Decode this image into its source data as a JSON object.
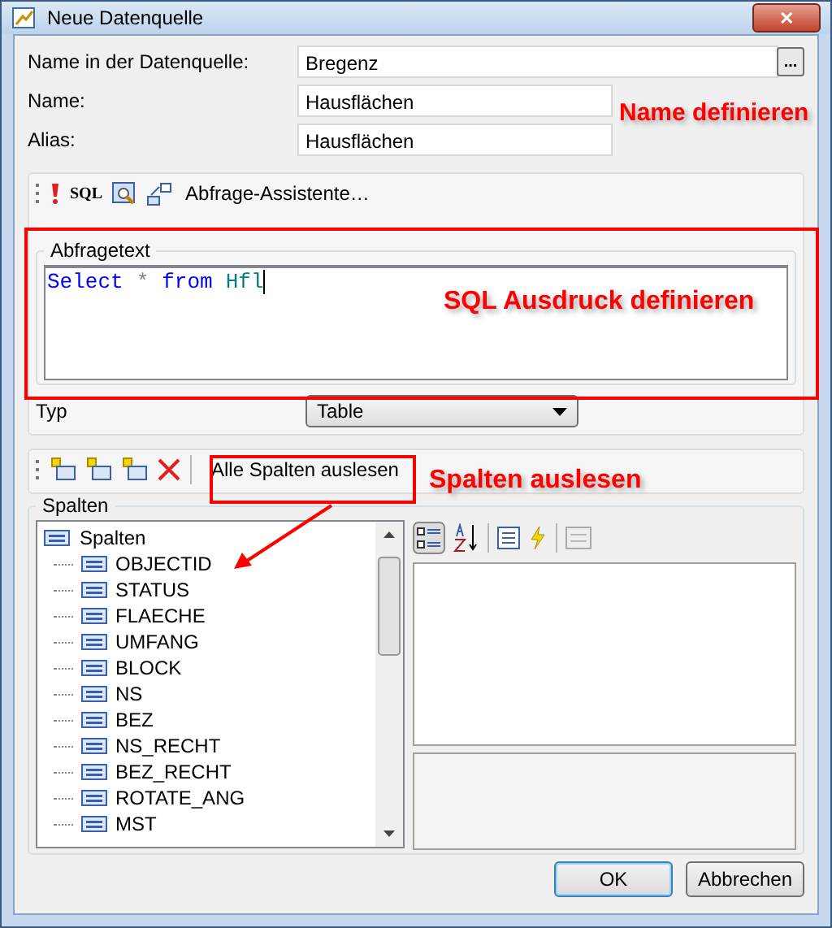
{
  "window": {
    "title": "Neue Datenquelle",
    "close": "✕"
  },
  "fields": [
    {
      "label": "Name in der Datenquelle:",
      "value": "Bregenz",
      "kind": "wide",
      "browse": "..."
    },
    {
      "label": "Name:",
      "value": "Hausflächen",
      "kind": "short"
    },
    {
      "label": "Alias:",
      "value": "Hausflächen",
      "kind": "short"
    }
  ],
  "query_toolbar": {
    "sql": "SQL",
    "wizard": "Abfrage-Assistente…"
  },
  "query_group": {
    "title": "Abfragetext",
    "tokens": [
      {
        "text": "Select",
        "kind": "keyword"
      },
      {
        "text": "*",
        "kind": "operator"
      },
      {
        "text": "from",
        "kind": "keyword"
      },
      {
        "text": "Hfl",
        "kind": "identifier"
      }
    ]
  },
  "type": {
    "label": "Typ",
    "value": "Table"
  },
  "columns_toolbar": {
    "button": "Alle Spalten auslesen"
  },
  "columns_group": {
    "title": "Spalten",
    "tree": {
      "label": "Spalten",
      "children": [
        {
          "label": "OBJECTID"
        },
        {
          "label": "STATUS"
        },
        {
          "label": "FLAECHE"
        },
        {
          "label": "UMFANG"
        },
        {
          "label": "BLOCK"
        },
        {
          "label": "NS"
        },
        {
          "label": "BEZ"
        },
        {
          "label": "NS_RECHT"
        },
        {
          "label": "BEZ_RECHT"
        },
        {
          "label": "ROTATE_ANG"
        },
        {
          "label": "MST"
        }
      ]
    }
  },
  "buttons": [
    {
      "label": "OK",
      "default": true
    },
    {
      "label": "Abbrechen",
      "default": false
    }
  ],
  "annotations": [
    {
      "text": "Name definieren",
      "kind": "name"
    },
    {
      "text": "SQL Ausdruck definieren",
      "kind": "sql"
    },
    {
      "text": "Spalten auslesen",
      "kind": "columns"
    }
  ]
}
